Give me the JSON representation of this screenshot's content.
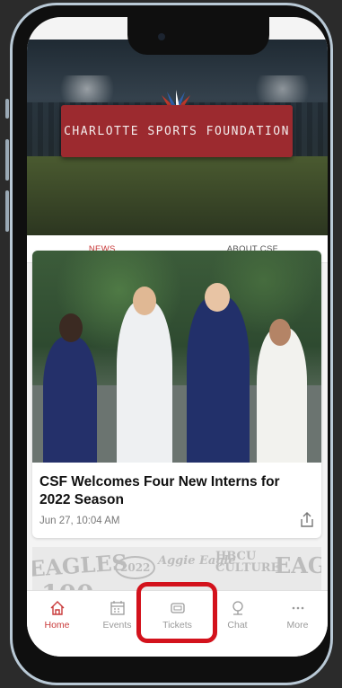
{
  "hero": {
    "banner_text": "CHARLOTTE SPORTS FOUNDATION"
  },
  "tabs": [
    {
      "label": "NEWS",
      "active": true
    },
    {
      "label": "ABOUT CSF",
      "active": false
    }
  ],
  "article": {
    "title": "CSF Welcomes Four New Interns for 2022 Season",
    "date": "Jun 27, 10:04 AM"
  },
  "second_card": {
    "graffiti": [
      "EAGLES",
      "2022",
      "Aggie Eagle",
      "HBCU CULTURE",
      "EAGL",
      "100"
    ]
  },
  "nav": {
    "items": [
      {
        "label": "Home",
        "icon": "home-icon",
        "active": true
      },
      {
        "label": "Events",
        "icon": "calendar-icon",
        "active": false
      },
      {
        "label": "Tickets",
        "icon": "ticket-icon",
        "active": false
      },
      {
        "label": "Chat",
        "icon": "chat-icon",
        "active": false
      },
      {
        "label": "More",
        "icon": "more-icon",
        "active": false
      }
    ]
  },
  "colors": {
    "accent": "#c93a3a",
    "highlight": "#d3121c",
    "banner": "#9c2a2f"
  }
}
